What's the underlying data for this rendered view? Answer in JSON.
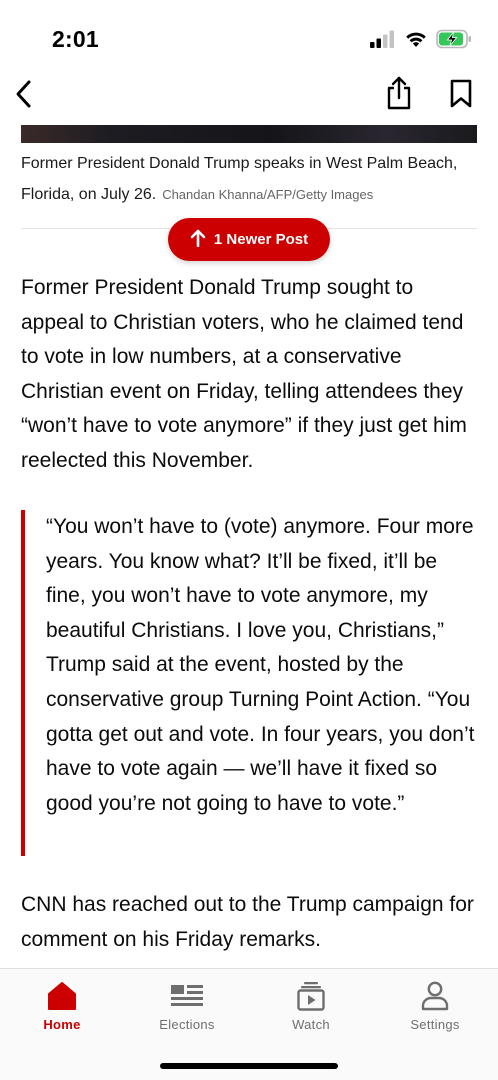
{
  "status_bar": {
    "time": "2:01",
    "icons": [
      "cellular-signal-icon",
      "wifi-icon",
      "battery-charging-icon"
    ]
  },
  "nav": {
    "back_icon": "chevron-left-icon",
    "share_icon": "share-icon",
    "bookmark_icon": "bookmark-icon"
  },
  "article": {
    "caption": "Former President Donald Trump speaks in West Palm Beach, Florida, on July 26.",
    "caption_credit": "Chandan Khanna/AFP/Getty Images",
    "newer_post_label": "1 Newer Post",
    "paragraph_1": "Former President Donald Trump sought to appeal to Christian voters, who he claimed tend to vote in low numbers, at a conservative Christian event on Friday, telling attendees they “won’t have to vote anymore” if they just get him reelected this November.",
    "quote": "“You won’t have to (vote) anymore. Four more years. You know what? It’ll be fixed, it’ll be fine, you won’t have to vote anymore, my beautiful Christians. I love you, Christians,” Trump said at the event, hosted by the conservative group Turning Point Action. “You gotta get out and vote. In four years, you don’t have to vote again — we’ll have it fixed so good you’re not going to have to vote.”",
    "paragraph_2": "CNN has reached out to the Trump campaign for comment on his Friday remarks."
  },
  "tab_bar": {
    "active": "Home",
    "tabs": [
      {
        "label": "Home",
        "icon": "home-icon"
      },
      {
        "label": "Elections",
        "icon": "elections-icon"
      },
      {
        "label": "Watch",
        "icon": "watch-icon"
      },
      {
        "label": "Settings",
        "icon": "person-icon"
      }
    ]
  },
  "colors": {
    "accent": "#cc0000",
    "text": "#0c0c0c",
    "muted": "#6e6e6e",
    "battery": "#34c759"
  }
}
